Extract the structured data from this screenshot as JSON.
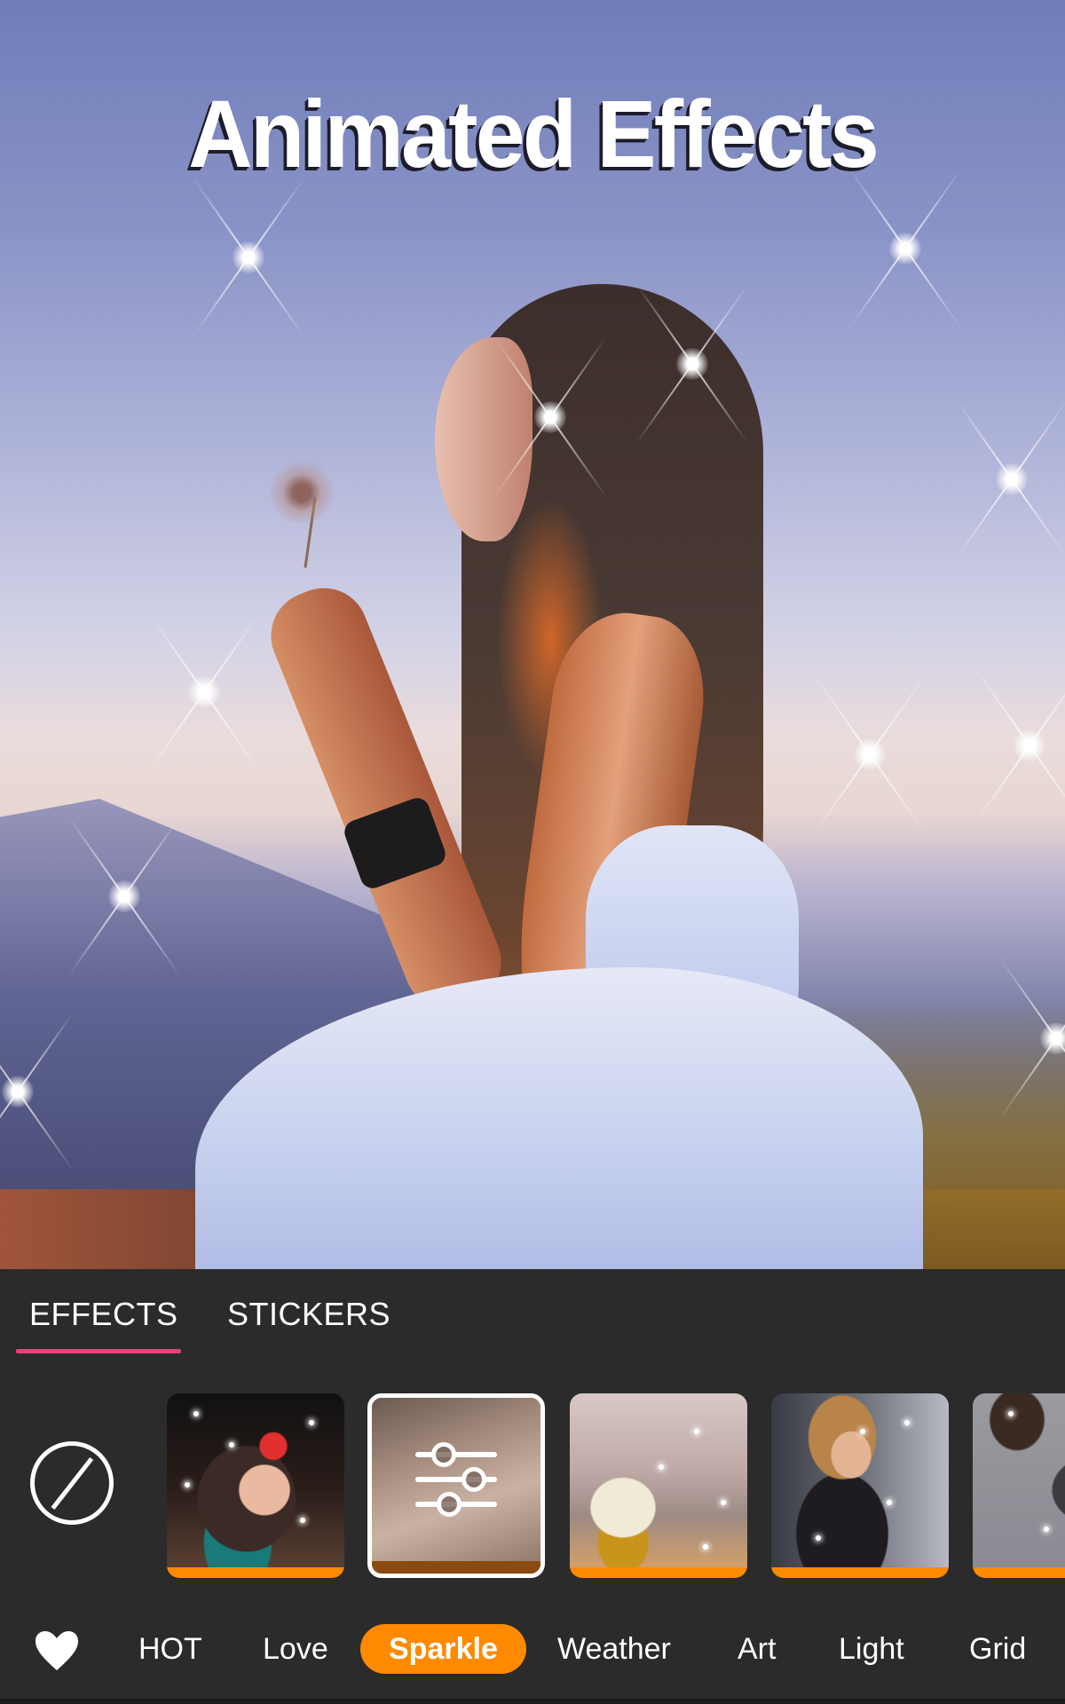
{
  "banner": {
    "headline": "Animated Effects"
  },
  "panel": {
    "tabs": [
      {
        "label": "EFFECTS",
        "active": true
      },
      {
        "label": "STICKERS",
        "active": false
      }
    ],
    "accent_color": "#e0457a",
    "none_button_icon": "no-effect-icon",
    "thumbnails": [
      {
        "name": "sparkle-portrait-flower",
        "selected": false
      },
      {
        "name": "sparkle-adjust",
        "selected": true,
        "overlay_icon": "adjust-sliders-icon"
      },
      {
        "name": "sparkle-jar-bokeh",
        "selected": false
      },
      {
        "name": "sparkle-curly-hair",
        "selected": false
      },
      {
        "name": "sparkle-christmas-book",
        "selected": false
      }
    ],
    "thumbnail_bar_color": "#ff8a00"
  },
  "categories": {
    "favorites_icon": "heart-icon",
    "items": [
      {
        "label": "HOT",
        "active": false
      },
      {
        "label": "Love",
        "active": false
      },
      {
        "label": "Sparkle",
        "active": true
      },
      {
        "label": "Weather",
        "active": false
      },
      {
        "label": "Art",
        "active": false
      },
      {
        "label": "Light",
        "active": false
      },
      {
        "label": "Grid",
        "active": false
      }
    ],
    "active_color": "#ff8a00"
  }
}
